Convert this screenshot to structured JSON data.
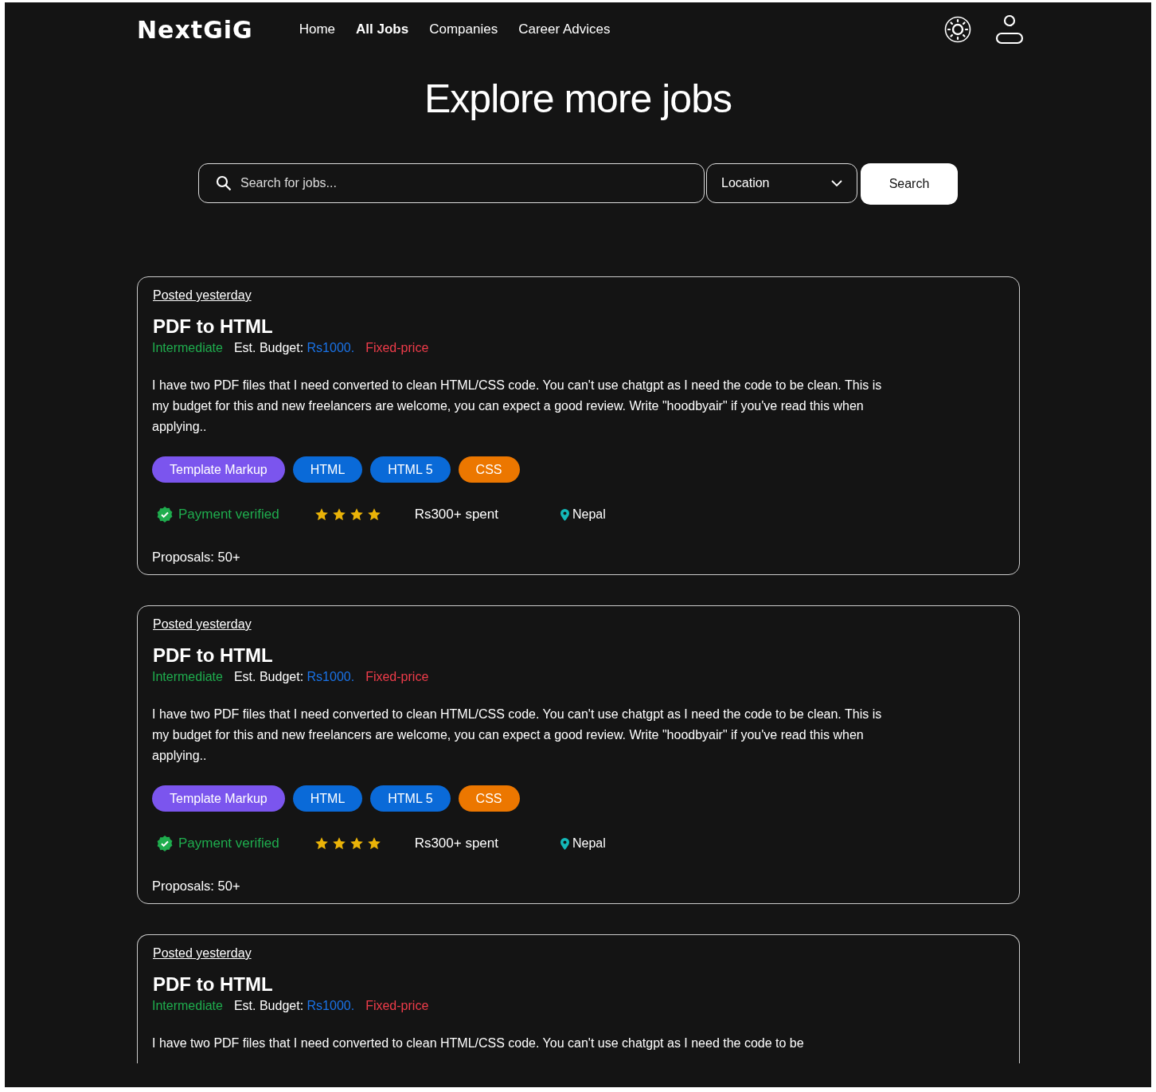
{
  "nav": {
    "logo": "NextGiG",
    "links": [
      {
        "label": "Home",
        "selected": false
      },
      {
        "label": "All Jobs",
        "selected": true
      },
      {
        "label": "Companies",
        "selected": false
      },
      {
        "label": "Career Advices",
        "selected": false
      }
    ]
  },
  "hero": {
    "title": "Explore more jobs"
  },
  "search": {
    "placeholder": "Search for jobs...",
    "location": "Location",
    "button": "Search"
  },
  "jobs": [
    {
      "posted": "Posted yesterday",
      "title": "PDF to HTML",
      "level": "Intermediate",
      "budget_label": "Est. Budget:",
      "budget_value": "Rs1000.",
      "pricing": "Fixed-price",
      "description": "I have two PDF files that I need converted to clean HTML/CSS code. You can't use chatgpt as I need the code to be clean. This is my budget for this and new freelancers are welcome, you can expect a good review. Write \"hoodbyair\" if you've read this when applying..",
      "tags": [
        {
          "label": "Template Markup",
          "color": "#7b55ee"
        },
        {
          "label": "HTML",
          "color": "#0a6ad8"
        },
        {
          "label": "HTML 5",
          "color": "#0a6ad8"
        },
        {
          "label": "CSS",
          "color": "#ec7700"
        }
      ],
      "payment": "Payment verified",
      "stars": 4,
      "spent": "Rs300+ spent",
      "location": "Nepal",
      "proposals": "Proposals: 50+"
    },
    {
      "posted": "Posted yesterday",
      "title": "PDF to HTML",
      "level": "Intermediate",
      "budget_label": "Est. Budget:",
      "budget_value": "Rs1000.",
      "pricing": "Fixed-price",
      "description": "I have two PDF files that I need converted to clean HTML/CSS code. You can't use chatgpt as I need the code to be clean. This is my budget for this and new freelancers are welcome, you can expect a good review. Write \"hoodbyair\" if you've read this when applying..",
      "tags": [
        {
          "label": "Template Markup",
          "color": "#7b55ee"
        },
        {
          "label": "HTML",
          "color": "#0a6ad8"
        },
        {
          "label": "HTML 5",
          "color": "#0a6ad8"
        },
        {
          "label": "CSS",
          "color": "#ec7700"
        }
      ],
      "payment": "Payment verified",
      "stars": 4,
      "spent": "Rs300+ spent",
      "location": "Nepal",
      "proposals": "Proposals: 50+"
    },
    {
      "posted": "Posted yesterday",
      "title": "PDF to HTML",
      "level": "Intermediate",
      "budget_label": "Est. Budget:",
      "budget_value": "Rs1000.",
      "pricing": "Fixed-price",
      "description": "I have two PDF files that I need converted to clean HTML/CSS code. You can't use chatgpt as I need the code to be"
    }
  ]
}
